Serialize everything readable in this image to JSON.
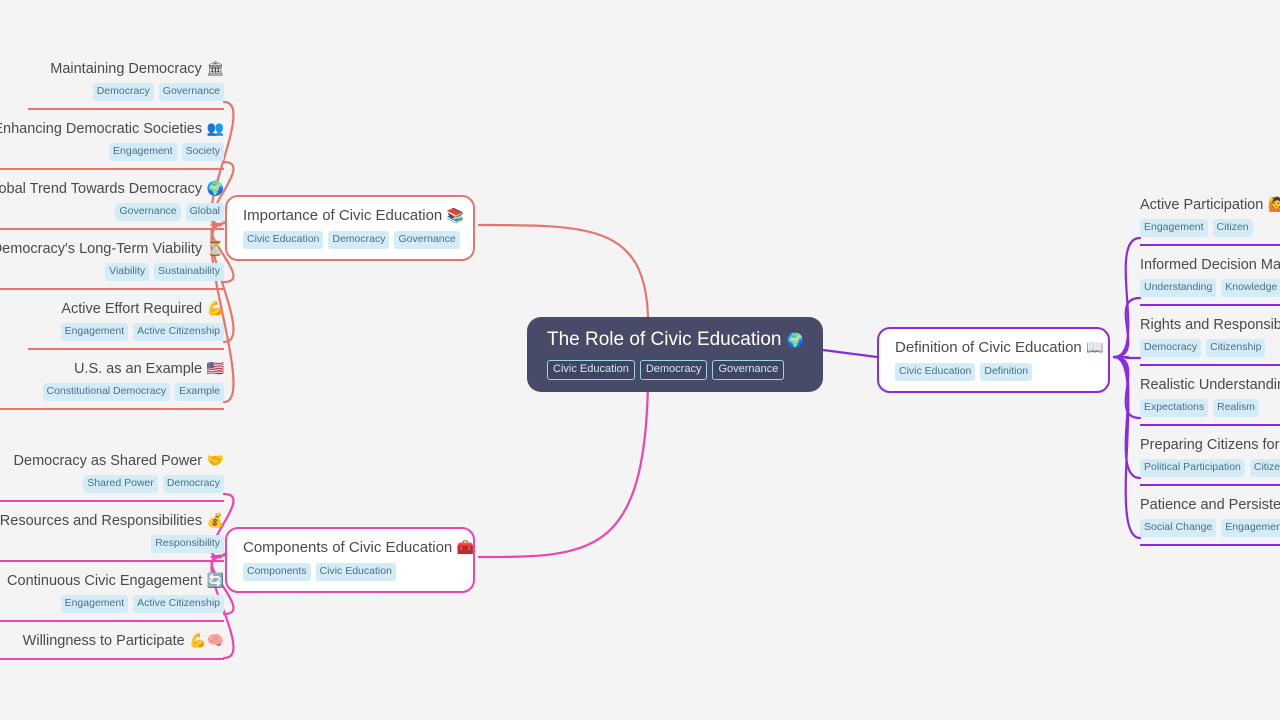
{
  "theme": {
    "background": "#f4f4f4",
    "center_fill": "#474b68",
    "center_text": "#ffffff",
    "branch_red": "#e4766e",
    "branch_pink": "#ea46ae",
    "branch_purple": "#8a2be2",
    "tag_fill": "#d4ecf7",
    "tag_text": "#4d6f86",
    "node_text": "#4a4a4a"
  },
  "center": {
    "title": "The Role of Civic Education",
    "emoji": "🌍",
    "tags": [
      "Civic Education",
      "Democracy",
      "Governance"
    ]
  },
  "branches": [
    {
      "id": "importance",
      "title": "Importance of Civic Education",
      "emoji": "📚",
      "color": "#e4766e",
      "tags": [
        "Civic Education",
        "Democracy",
        "Governance"
      ],
      "children": [
        {
          "title": "Maintaining Democracy",
          "emoji": "🏛",
          "tags": [
            "Democracy",
            "Governance"
          ]
        },
        {
          "title": "Enhancing Democratic Societies",
          "emoji": "👥",
          "tags": [
            "Engagement",
            "Society"
          ]
        },
        {
          "title": "Global Trend Towards Democracy",
          "emoji": "🌍",
          "tags": [
            "Governance",
            "Global"
          ]
        },
        {
          "title": "Democracy's Long-Term Viability",
          "emoji": "⏳",
          "tags": [
            "Viability",
            "Sustainability"
          ]
        },
        {
          "title": "Active Effort Required",
          "emoji": "💪",
          "tags": [
            "Engagement",
            "Active Citizenship"
          ]
        },
        {
          "title": "U.S. as an Example",
          "emoji": "🇺🇸",
          "tags": [
            "Constitutional Democracy",
            "Example"
          ]
        }
      ]
    },
    {
      "id": "components",
      "title": "Components of Civic Education",
      "emoji": "🧰",
      "color": "#ea46ae",
      "tags": [
        "Components",
        "Civic Education"
      ],
      "children": [
        {
          "title": "Democracy as Shared Power",
          "emoji": "🤝",
          "tags": [
            "Shared Power",
            "Democracy"
          ]
        },
        {
          "title": "Resources and Responsibilities",
          "emoji": "💰",
          "tags": [
            "Responsibility"
          ]
        },
        {
          "title": "Continuous Civic Engagement",
          "emoji": "🔄",
          "tags": [
            "Engagement",
            "Active Citizenship"
          ]
        },
        {
          "title": "Willingness to Participate",
          "emoji": "💪🧠",
          "tags": []
        }
      ]
    },
    {
      "id": "definition",
      "title": "Definition of Civic Education",
      "emoji": "📖",
      "color": "#8a2be2",
      "tags": [
        "Civic Education",
        "Definition"
      ],
      "children": [
        {
          "title": "Active Participation",
          "emoji": "🙋",
          "tags": [
            "Engagement",
            "Citizen"
          ]
        },
        {
          "title": "Informed Decision Making",
          "emoji": "",
          "tags": [
            "Understanding",
            "Knowledge"
          ]
        },
        {
          "title": "Rights and Responsibilities",
          "emoji": "",
          "tags": [
            "Democracy",
            "Citizenship"
          ]
        },
        {
          "title": "Realistic Understanding",
          "emoji": "",
          "tags": [
            "Expectations",
            "Realism"
          ]
        },
        {
          "title": "Preparing Citizens for Politics",
          "emoji": "",
          "tags": [
            "Political Participation",
            "Citizenship"
          ]
        },
        {
          "title": "Patience and Persistence",
          "emoji": "",
          "tags": [
            "Social Change",
            "Engagement"
          ]
        }
      ]
    }
  ]
}
